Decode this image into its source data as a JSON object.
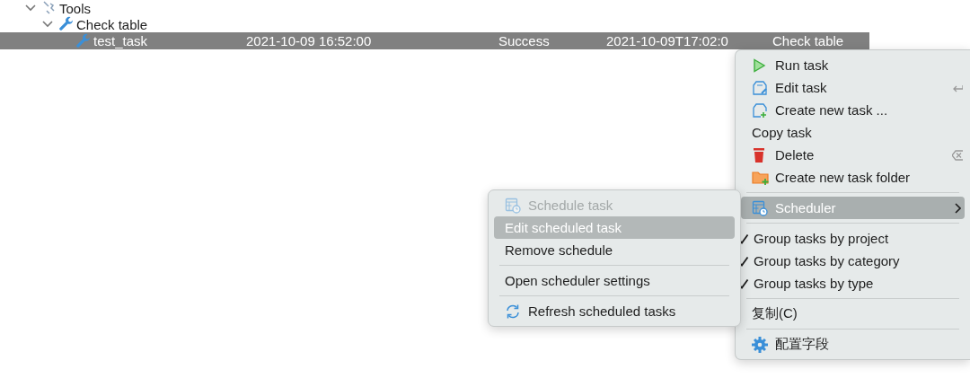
{
  "tree": [
    {
      "label": "Tools",
      "expanded": true,
      "children": [
        {
          "label": "Check table",
          "expanded": true,
          "children": [
            {
              "label": "test_task",
              "selected": true,
              "columns": [
                "2021-10-09 16:52:00",
                "Success",
                "2021-10-09T17:02:0",
                "Check table"
              ]
            }
          ]
        }
      ]
    }
  ],
  "context_menu": {
    "items": [
      {
        "kind": "item",
        "label": "Run task",
        "selected": false
      },
      {
        "kind": "item",
        "label": "Edit task",
        "selected": false
      },
      {
        "kind": "item",
        "label": "Create new task ...",
        "selected": false
      },
      {
        "kind": "item",
        "label": "Copy task",
        "selected": false
      },
      {
        "kind": "item",
        "label": "Delete",
        "selected": false
      },
      {
        "kind": "item",
        "label": "Create new task folder",
        "selected": false
      },
      {
        "kind": "separator"
      },
      {
        "kind": "submenu",
        "label": "Scheduler",
        "selected": true
      },
      {
        "kind": "separator"
      },
      {
        "kind": "check",
        "label": "Group tasks by project",
        "checked": true
      },
      {
        "kind": "check",
        "label": "Group tasks by category",
        "checked": true
      },
      {
        "kind": "check",
        "label": "Group tasks by type",
        "checked": true
      },
      {
        "kind": "separator"
      },
      {
        "kind": "item",
        "label": "复制(C)",
        "selected": false
      },
      {
        "kind": "separator"
      },
      {
        "kind": "item",
        "label": "配置字段",
        "selected": false
      }
    ]
  },
  "scheduler_submenu": {
    "items": [
      {
        "kind": "item",
        "label": "Schedule task",
        "selected": false,
        "disabled": true
      },
      {
        "kind": "item",
        "label": "Edit scheduled task",
        "selected": true,
        "disabled": false
      },
      {
        "kind": "item",
        "label": "Remove schedule",
        "selected": false,
        "disabled": false
      },
      {
        "kind": "separator"
      },
      {
        "kind": "item",
        "label": "Open scheduler settings",
        "selected": false,
        "disabled": false
      },
      {
        "kind": "separator"
      },
      {
        "kind": "item",
        "label": "Refresh scheduled tasks",
        "selected": false,
        "disabled": false
      }
    ]
  }
}
